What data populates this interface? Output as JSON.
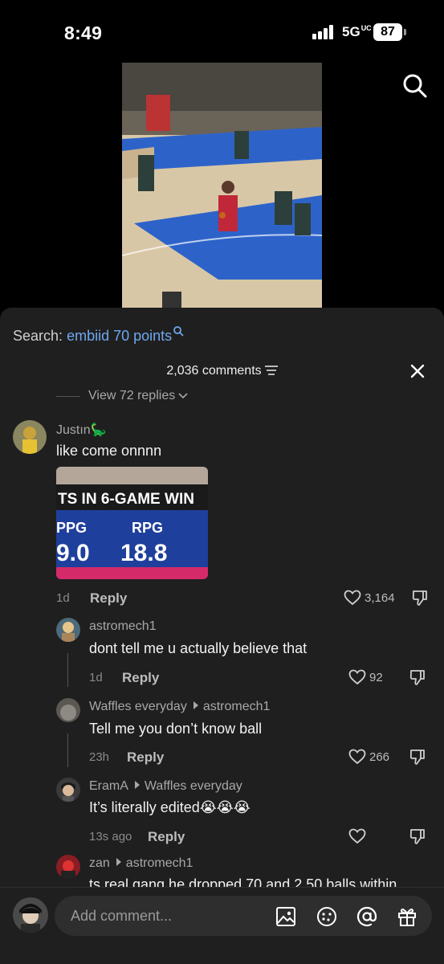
{
  "status_bar": {
    "time": "8:49",
    "network": "5G",
    "network_sup": "UC",
    "battery": "87"
  },
  "search": {
    "prefix": "Search:",
    "query": "embiid 70 points"
  },
  "header": {
    "comment_count": "2,036 comments"
  },
  "view_replies": "View 72 replies",
  "comments": [
    {
      "user": "Justın🦕",
      "text": "like come onnnn",
      "time": "1d",
      "reply_label": "Reply",
      "likes": "3,164",
      "image": {
        "title": "TS IN 6-GAME WIN",
        "col1_label": "PPG",
        "col1_value": "9.0",
        "col2_label": "RPG",
        "col2_value": "18.8"
      }
    },
    {
      "user": "astromech1",
      "text": "dont tell me u actually believe that",
      "time": "1d",
      "reply_label": "Reply",
      "likes": "92"
    },
    {
      "user": "Waffles everyday",
      "reply_to": "astromech1",
      "text": "Tell me you don’t know ball",
      "time": "23h",
      "reply_label": "Reply",
      "likes": "266"
    },
    {
      "user": "EramA",
      "reply_to": "Waffles everyday",
      "text": "It’s literally edited😭😭😭",
      "time": "13s ago",
      "reply_label": "Reply",
      "likes": ""
    },
    {
      "user": "zan",
      "reply_to": "astromech1",
      "text": "ts real gang he dropped 70 and 2 50 balls within"
    }
  ],
  "composer": {
    "placeholder": "Add comment..."
  },
  "colors": {
    "sheet_bg": "#1f1f1f",
    "link_blue": "#6ea8f0",
    "court_blue": "#2d63c9"
  }
}
